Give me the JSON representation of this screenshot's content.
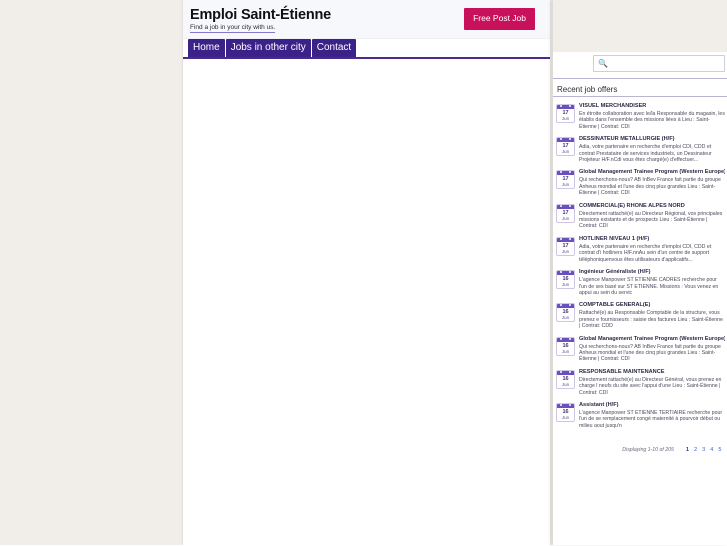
{
  "site": {
    "brand_title": "Emploi Saint-Étienne",
    "tagline": "Find a job in your city with us.",
    "post_job_label": "Free Post Job"
  },
  "nav": {
    "tabs": [
      {
        "label": "Home"
      },
      {
        "label": "Jobs in other city"
      },
      {
        "label": "Contact"
      }
    ]
  },
  "sidebar": {
    "search": {
      "icon": "search-icon",
      "value": "",
      "placeholder": ""
    },
    "heading": "Recent job offers",
    "jobs": [
      {
        "day": "17",
        "month": "Jun",
        "title": "VISUEL MERCHANDISER",
        "desc": "En étroite collaboration avec le/la Responsable du magasin, les établis dans l'ensemble des missions liées à Lieu : Saint-Étienne | Contrat: CDI"
      },
      {
        "day": "17",
        "month": "Jun",
        "title": "DESSINATEUR METALLURGIE (H/F)",
        "desc": "Adia, votre partenaire en recherche d'emploi CDI, CDD et contrat Prestataire de services industriels, un Dessinateur Projeteur H/F.nCdi vous êtes chargé(e) d'effectuer..."
      },
      {
        "day": "17",
        "month": "Jun",
        "title": "Global Management Trainee Program (Western Europe)",
        "desc": "Qui recherchons-nous? AB InBev France fait partie du groupe Anheus mondial et l'une des cinq plus grandes Lieu : Saint-Étienne | Contrat: CDI"
      },
      {
        "day": "17",
        "month": "Jun",
        "title": "COMMERCIAL(E) RHÔNE ALPES NORD",
        "desc": "Directement rattaché(e) au Directeur Régional, vos principales missions existants et de prospects Lieu : Saint-Étienne | Contrat: CDI"
      },
      {
        "day": "17",
        "month": "Jun",
        "title": "HOTLINER NIVEAU 1 (H/F)",
        "desc": "Adia, votre partenaire en recherche d'emploi CDI, CDD et contrat d'i hotliners H/F.nnAu sein d'un centre de support téléphoniquenvous êtes utilisateurs d'applicatifs..."
      },
      {
        "day": "16",
        "month": "Jun",
        "title": "Ingénieur Généraliste (H/F)",
        "desc": "L'agence Manpower ST ETIENNE CADRES recherche pour l'un de ses basé sur ST ETIENNE. Missions : Vous venez en appui au sein du servic"
      },
      {
        "day": "16",
        "month": "Jun",
        "title": "COMPTABLE GÉNÉRAL(E)",
        "desc": "Rattaché(e) au Responsable Comptable de la structure, vous prenez e fournisseurs : saisie des factures Lieu : Saint-Étienne | Contrat: CDD"
      },
      {
        "day": "16",
        "month": "Jun",
        "title": "Global Management Trainee Program (Western Europe)",
        "desc": "Qui recherchons-nous? AB InBev France fait partie du groupe Anheus mondial et l'une des cinq plus grandes Lieu : Saint-Étienne | Contrat: CDI"
      },
      {
        "day": "16",
        "month": "Jun",
        "title": "RESPONSABLE MAINTENANCE",
        "desc": "Directement rattaché(e) au Directeur Général, vous prenez en charge l neufs du site avec l'appui d'une Lieu : Saint-Étienne | Contrat: CDI"
      },
      {
        "day": "16",
        "month": "Jun",
        "title": "Assistant (H/F)",
        "desc": "L'agence Manpower ST ETIENNE TERTIAIRE recherche pour l'un de se remplacement congé maternité à pourvoir début ou milieu aout jusqu'n"
      }
    ],
    "pagination": {
      "label": "Displaying 1-10 of 205",
      "pages": [
        "1",
        "2",
        "3",
        "4",
        "5"
      ],
      "current_index": 0
    }
  }
}
